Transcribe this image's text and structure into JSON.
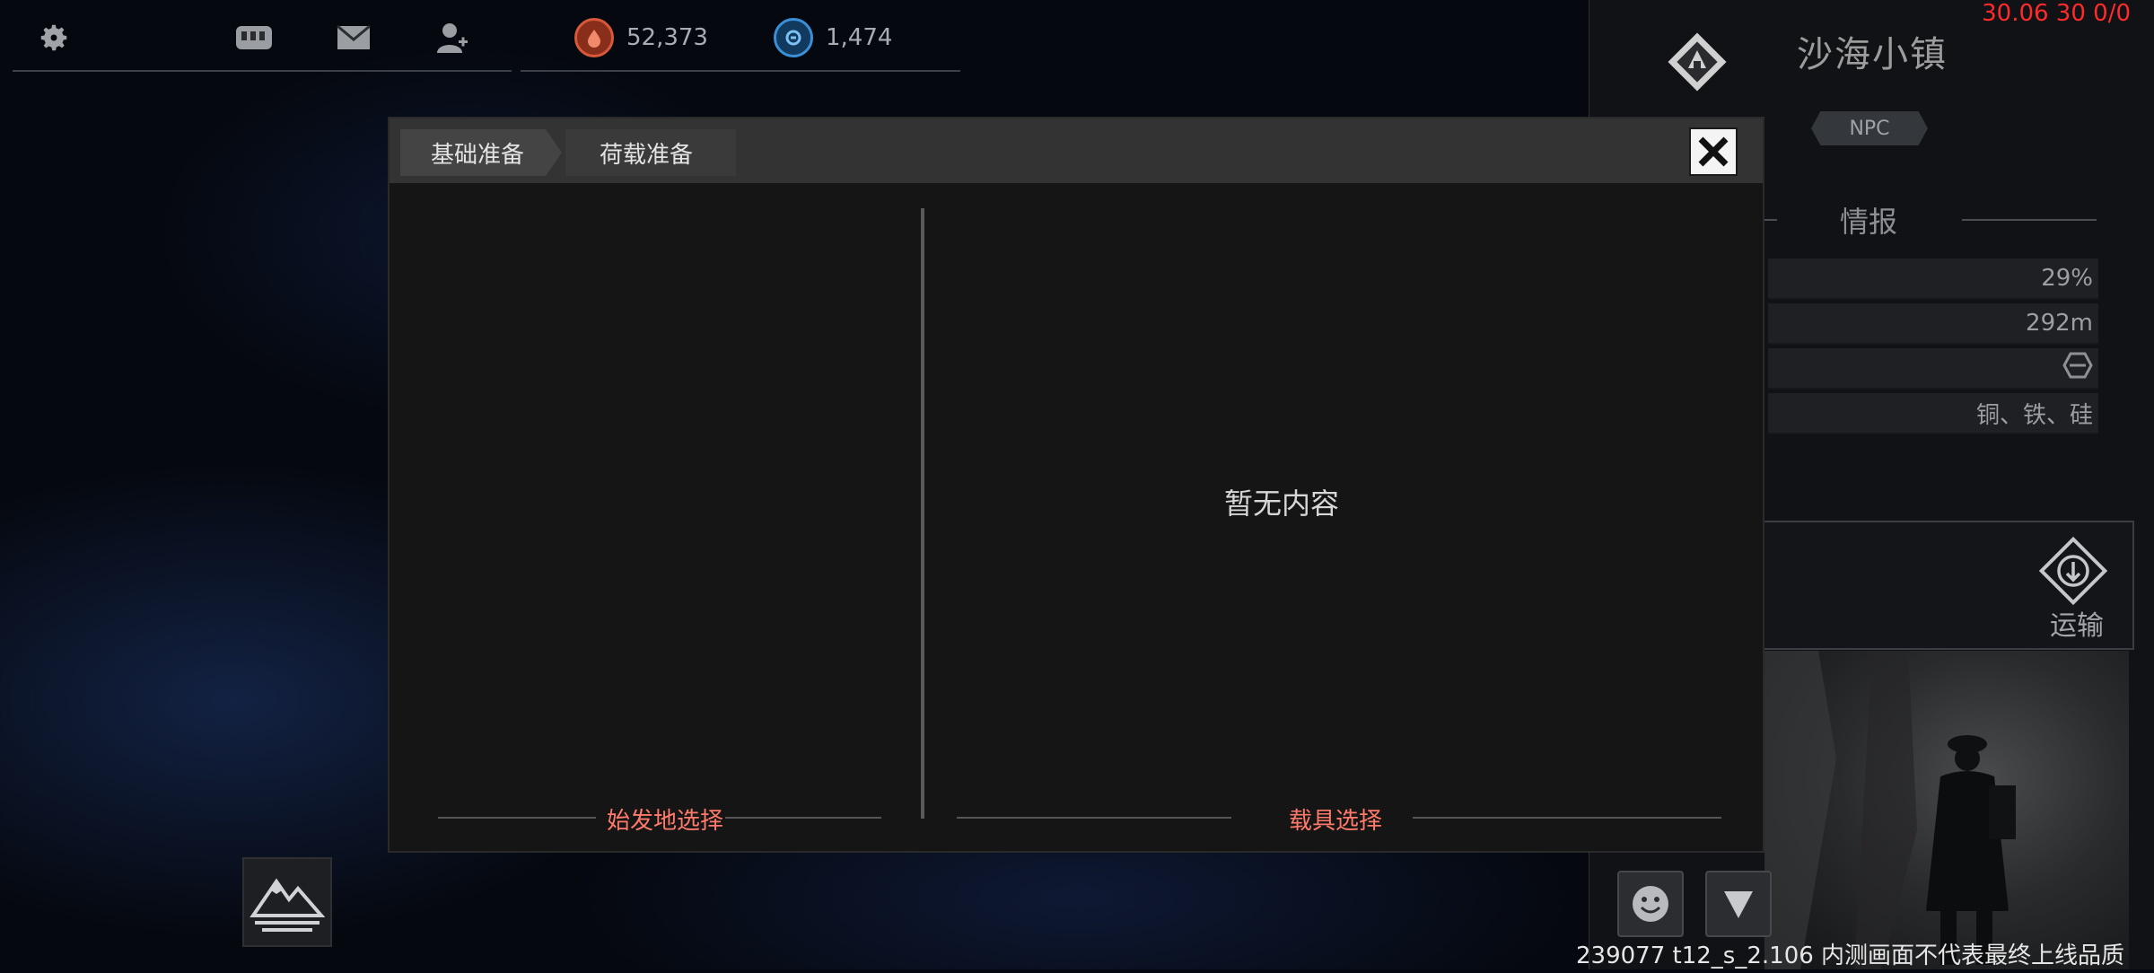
{
  "topbar": {
    "icons": [
      "gear-icon",
      "chat-icon",
      "mail-icon",
      "friends-icon"
    ],
    "resource1": {
      "value": "52,373",
      "color": "#e25a3a"
    },
    "resource2": {
      "value": "1,474",
      "color": "#3a8fd6"
    }
  },
  "perf_text": "30.06 30 0/0",
  "location": {
    "name": "沙海小镇",
    "tag": "NPC",
    "intel_title": "情报",
    "rows": [
      "29%",
      "292m",
      "",
      "铜、铁、硅"
    ]
  },
  "transport_label": "运输",
  "dialog": {
    "tabs": [
      "基础准备",
      "荷载准备"
    ],
    "empty_text": "暂无内容",
    "left_footer": "始发地选择",
    "right_footer": "载具选择"
  },
  "build_note": "239077 t12_s_2.106  内测画面不代表最终上线品质",
  "colors": {
    "accent_red": "#ff7a6b",
    "perf_red": "#ff2a2a"
  }
}
